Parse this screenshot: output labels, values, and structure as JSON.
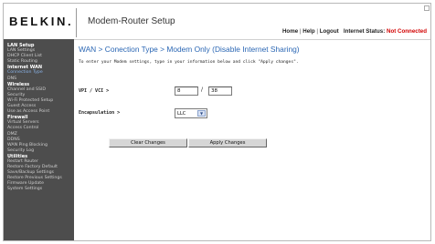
{
  "header": {
    "logo": "BELKIN.",
    "app_title": "Modem-Router Setup",
    "nav": {
      "home": "Home",
      "help": "Help",
      "logout": "Logout",
      "status_label": "Internet Status:",
      "status_value": "Not Connected"
    }
  },
  "sidebar": {
    "groups": [
      {
        "title": "LAN Setup",
        "items": [
          "LAN Settings",
          "DHCP Client List",
          "Static Routing"
        ]
      },
      {
        "title": "Internet WAN",
        "items": [
          "Connection Type",
          "DNS"
        ]
      },
      {
        "title": "Wireless",
        "items": [
          "Channel and SSID",
          "Security",
          "Wi-Fi Protected Setup",
          "Guest Access",
          "Use as Access Point"
        ]
      },
      {
        "title": "Firewall",
        "items": [
          "Virtual Servers",
          "Access Control",
          "DMZ",
          "DDNS",
          "WAN Ping Blocking",
          "Security Log"
        ]
      },
      {
        "title": "Utilities",
        "items": [
          "Restart Router",
          "Restore Factory Default",
          "Save/Backup Settings",
          "Restore Previous Settings",
          "Firmware Update",
          "System Settings"
        ]
      }
    ]
  },
  "main": {
    "title": "WAN > Conection Type > Modem Only (Disable Internet Sharing)",
    "intro": "To enter your Modem settings, type in your information below and click \"Apply changes\".",
    "vpi_vci_label": "VPI / VCI >",
    "vpi_value": "8",
    "vci_value": "38",
    "encapsulation_label": "Encapsulation >",
    "encapsulation_value": "LLC",
    "clear_button": "Clear Changes",
    "apply_button": "Apply Changes"
  },
  "colors": {
    "sidebar_bg": "#4d4d4d",
    "title_blue": "#2b67b4",
    "status_red": "#d20000",
    "active_item": "#89b3e8"
  }
}
